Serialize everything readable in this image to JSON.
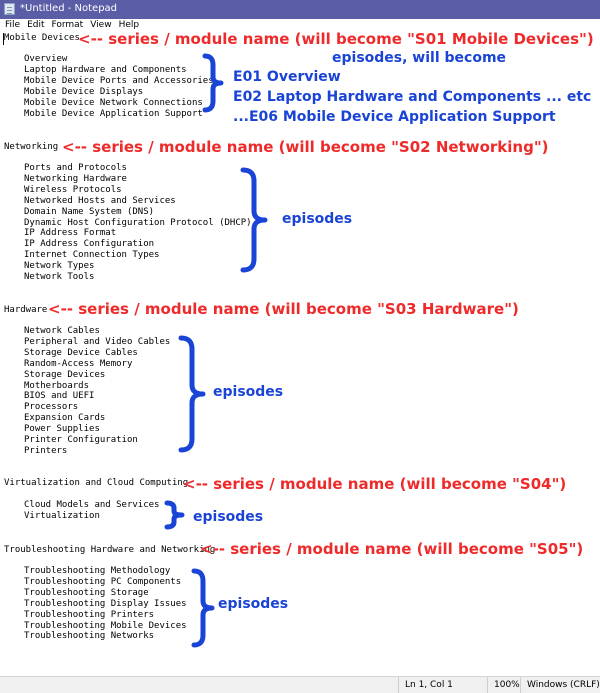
{
  "window": {
    "title": "*Untitled - Notepad"
  },
  "menu": [
    "File",
    "Edit",
    "Format",
    "View",
    "Help"
  ],
  "editor": {
    "modules": [
      {
        "name": "Mobile Devices",
        "episodes": [
          "Overview",
          "Laptop Hardware and Components",
          "Mobile Device Ports and Accessories",
          "Mobile Device Displays",
          "Mobile Device Network Connections",
          "Mobile Device Application Support"
        ]
      },
      {
        "name": "Networking",
        "episodes": [
          "Ports and Protocols",
          "Networking Hardware",
          "Wireless Protocols",
          "Networked Hosts and Services",
          "Domain Name System (DNS)",
          "Dynamic Host Configuration Protocol (DHCP)",
          "IP Address Format",
          "IP Address Configuration",
          "Internet Connection Types",
          "Network Types",
          "Network Tools"
        ]
      },
      {
        "name": "Hardware",
        "episodes": [
          "Network Cables",
          "Peripheral and Video Cables",
          "Storage Device Cables",
          "Random-Access Memory",
          "Storage Devices",
          "Motherboards",
          "BIOS and UEFI",
          "Processors",
          "Expansion Cards",
          "Power Supplies",
          "Printer Configuration",
          "Printers"
        ]
      },
      {
        "name": "Virtualization and Cloud Computing",
        "episodes": [
          "Cloud Models and Services",
          "Virtualization"
        ]
      },
      {
        "name": "Troubleshooting Hardware and Networking",
        "episodes": [
          "Troubleshooting Methodology",
          "Troubleshooting PC Components",
          "Troubleshooting Storage",
          "Troubleshooting Display Issues",
          "Troubleshooting Printers",
          "Troubleshooting Mobile Devices",
          "Troubleshooting Networks"
        ]
      }
    ]
  },
  "annotations": {
    "module_notes": [
      "<-- series / module name (will become \"S01 Mobile Devices\")",
      "<-- series / module name (will become \"S02 Networking\")",
      "<-- series / module name (will become \"S03 Hardware\")",
      "<-- series / module name (will become \"S04\")",
      "<-- series / module name (will become \"S05\")"
    ],
    "episodes_header": "episodes, will become",
    "e01": "E01 Overview",
    "e02": "E02 Laptop Hardware and Components ... etc",
    "e06": "...E06 Mobile Device Application Support",
    "episodes_label": "episodes",
    "brace_color": "#1a44d6",
    "note_color": "#ee2a2a"
  },
  "status": {
    "position": "Ln 1, Col 1",
    "zoom": "100%",
    "line_ending": "Windows (CRLF)"
  }
}
